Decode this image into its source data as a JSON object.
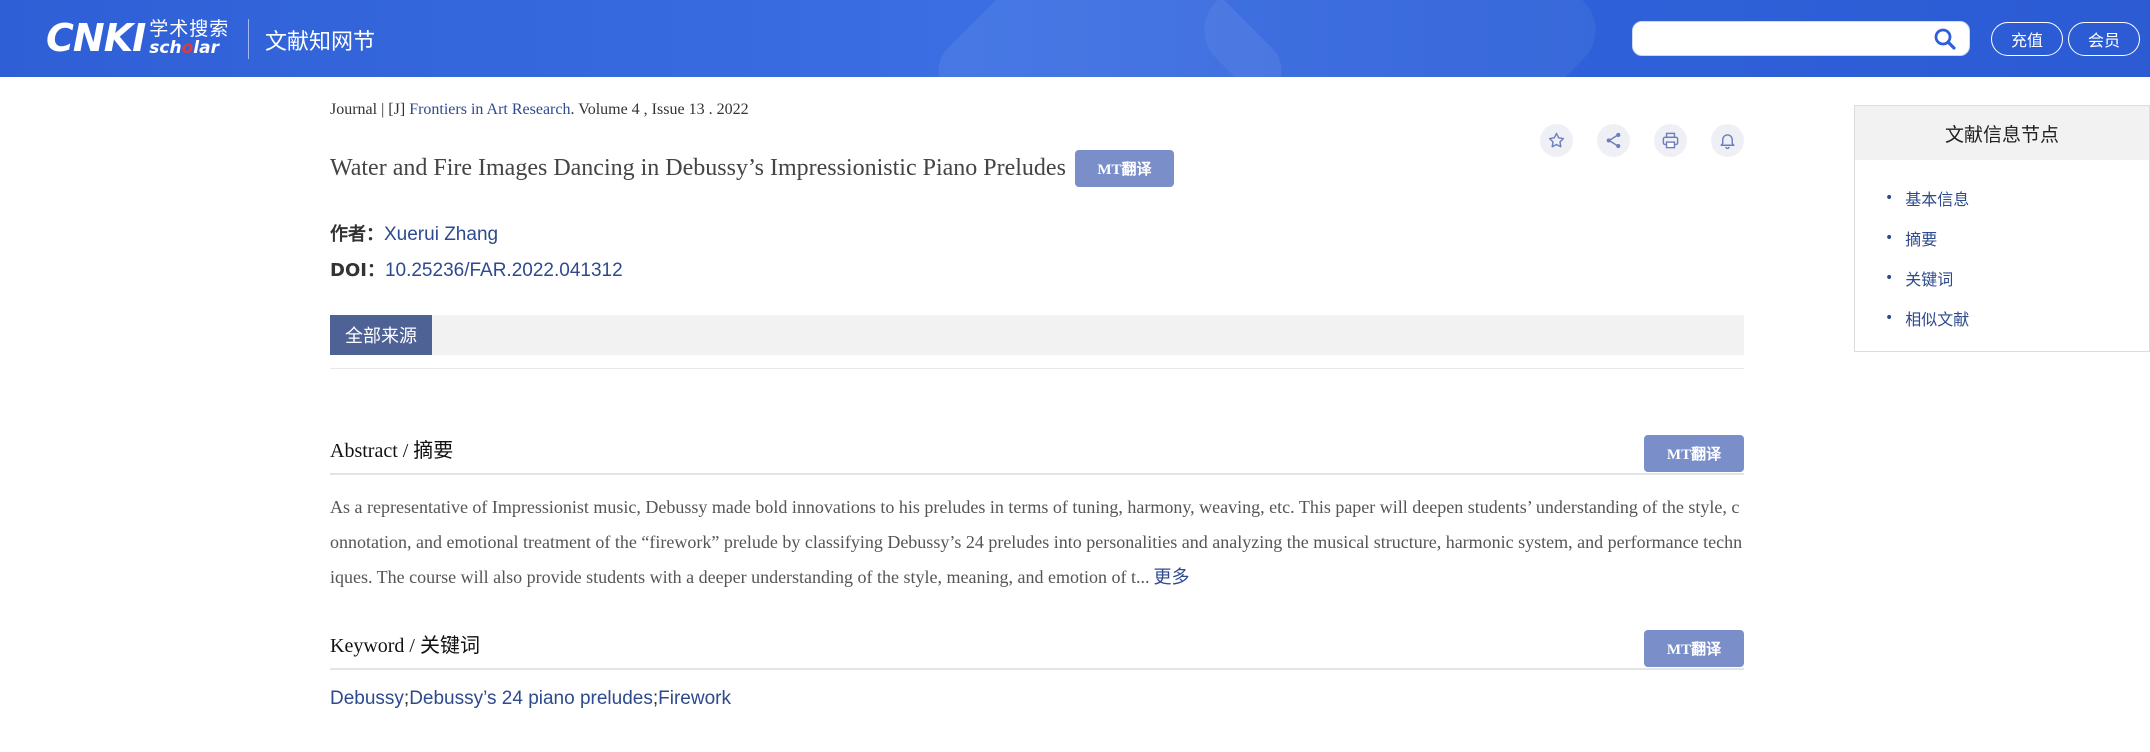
{
  "header": {
    "logo_main": "CNKI",
    "logo_cn": "学术搜索",
    "logo_en_pre": "sch",
    "logo_en_accent": "o",
    "logo_en_post": "lar",
    "site_title": "文献知网节",
    "search_value": "",
    "recharge_label": "充值",
    "member_label": "会员"
  },
  "breadcrumb": {
    "prefix": "Journal | [J] ",
    "journal": "Frontiers in Art Research",
    "suffix": ". Volume 4 , Issue 13 . 2022"
  },
  "article": {
    "title": "Water and Fire Images Dancing in Debussy’s Impressionistic Piano Preludes",
    "mt_label": "MT翻译",
    "author_label": "作者：",
    "author": "Xuerui Zhang",
    "doi_label": "DOI：",
    "doi": "10.25236/FAR.2022.041312"
  },
  "source_tab": "全部来源",
  "abstract": {
    "heading": "Abstract / 摘要",
    "mt_label": "MT翻译",
    "text": "As a representative of Impressionist music, Debussy made bold innovations to his preludes in terms of tuning, harmony, weaving, etc. This paper will deepen students’ understanding of the style, connotation, and emotional treatment of the “firework” prelude by classifying Debussy’s 24 preludes into personalities and analyzing the musical structure, harmonic system, and performance techniques. The course will also provide students with a deeper understanding of the style, meaning, and emotion of t...",
    "more_label": "更多"
  },
  "keyword": {
    "heading": "Keyword / 关键词",
    "mt_label": "MT翻译",
    "items": [
      "Debussy",
      "Debussy’s 24 piano preludes",
      "Firework"
    ],
    "separator": ";"
  },
  "side_panel": {
    "title": "文献信息节点",
    "items": [
      "基本信息",
      "摘要",
      "关键词",
      "相似文献"
    ]
  },
  "icons": [
    "star-icon",
    "share-icon",
    "print-icon",
    "bell-icon",
    "search-icon"
  ],
  "colors": {
    "header_blue": "#3a6ee2",
    "link_blue": "#2e4a8f",
    "mt_button": "#7a8fc9",
    "source_tab": "#4f6296"
  }
}
